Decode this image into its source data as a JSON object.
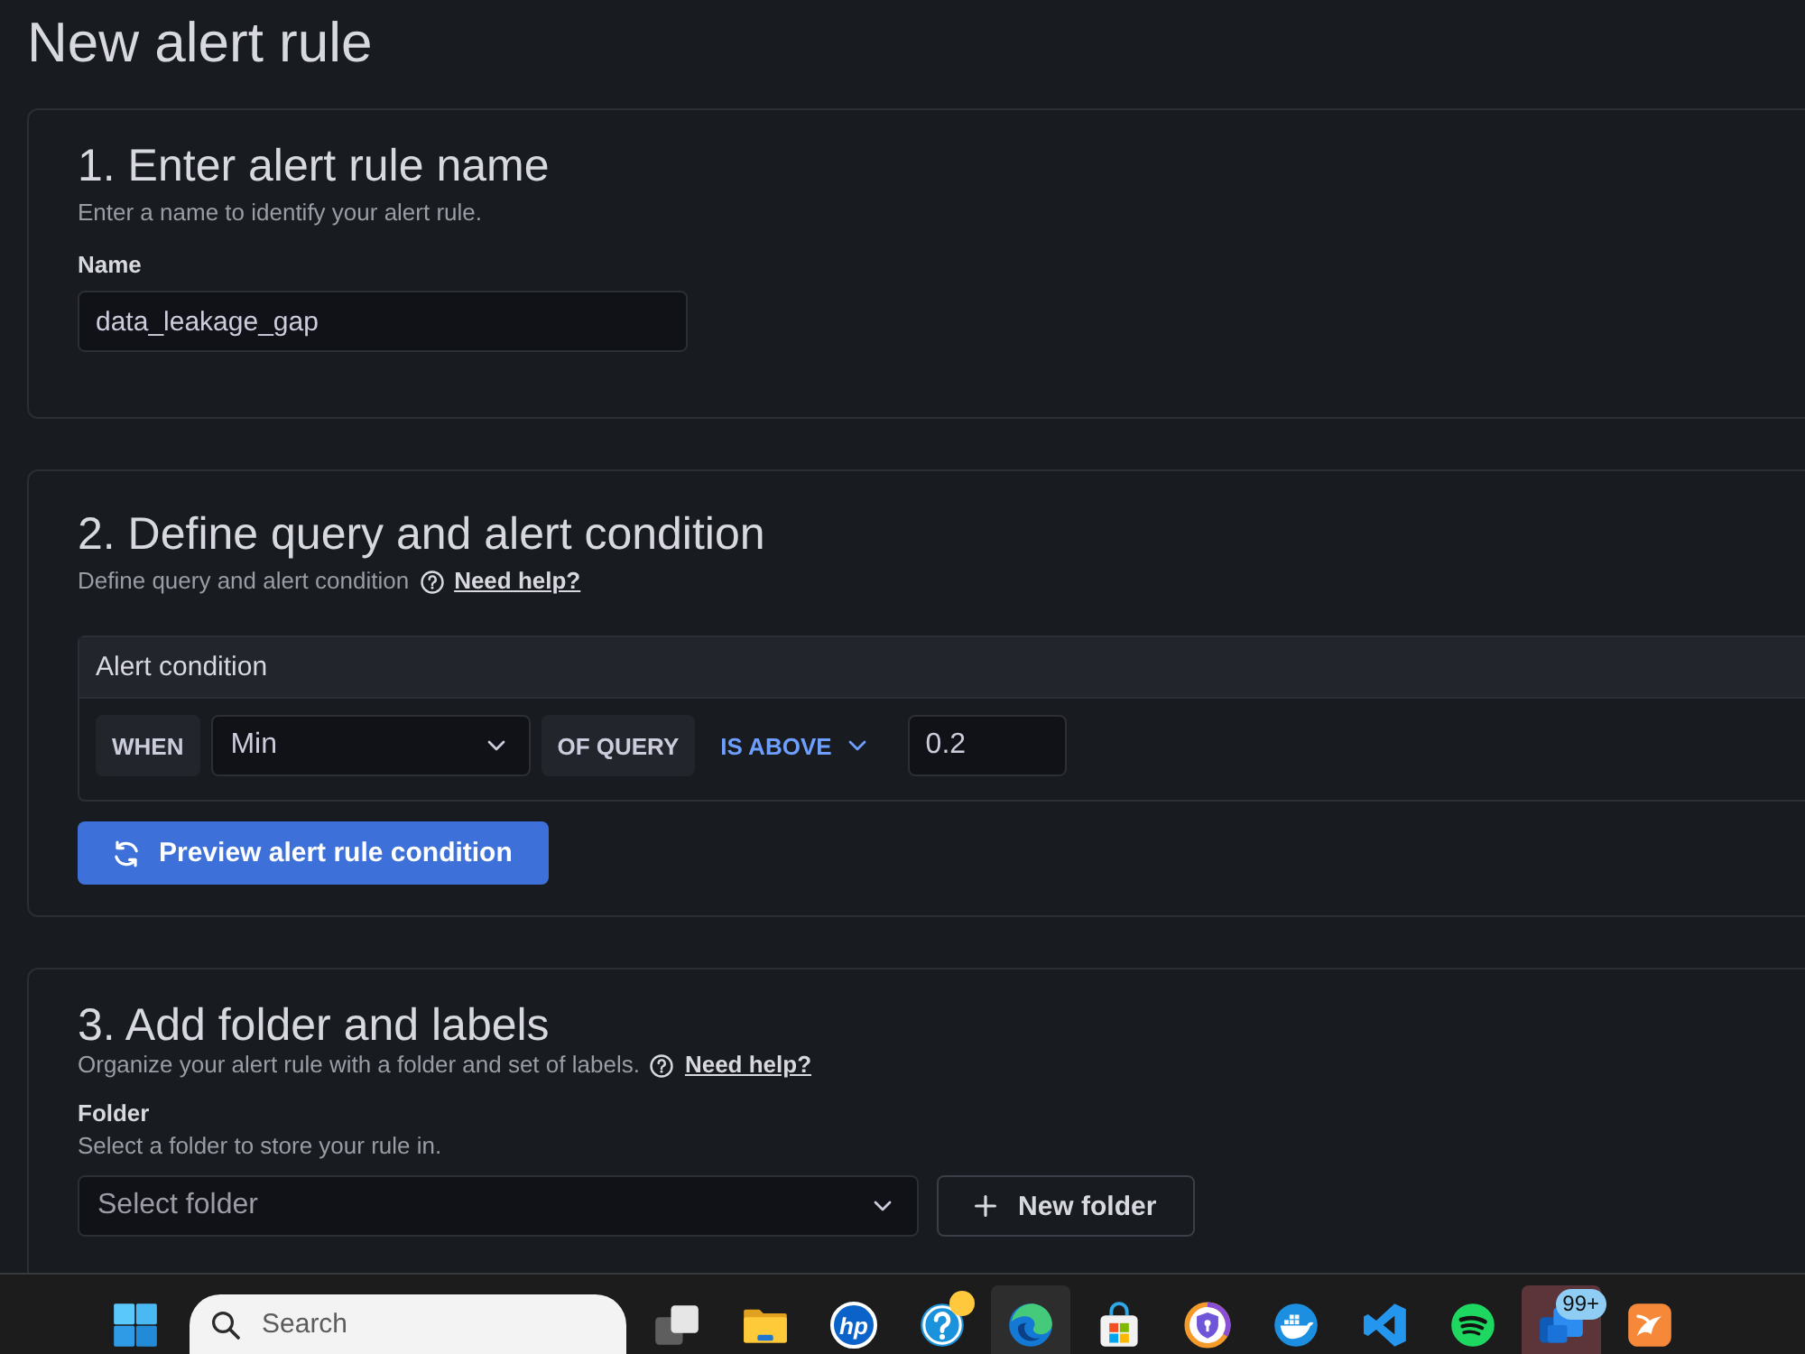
{
  "page": {
    "title": "New alert rule"
  },
  "sections": [
    {
      "kind": "name",
      "heading": "1. Enter alert rule name",
      "description": "Enter a name to identify your alert rule.",
      "field": {
        "label": "Name",
        "value": "data_leakage_gap"
      }
    },
    {
      "kind": "query",
      "heading": "2. Define query and alert condition",
      "description": "Define query and alert condition",
      "help_link": "Need help?",
      "condition": {
        "title": "Alert condition",
        "when": "WHEN",
        "reducer": "Min",
        "of_query": "OF QUERY",
        "evaluator": "IS ABOVE",
        "threshold": "0.2"
      },
      "button": "Preview alert rule condition"
    },
    {
      "kind": "folder",
      "heading": "3. Add folder and labels",
      "description": "Organize your alert rule with a folder and set of labels.",
      "help_link": "Need help?",
      "field": {
        "label": "Folder",
        "hint": "Select a folder to store your rule in.",
        "placeholder": "Select folder"
      },
      "button": "New folder"
    }
  ],
  "taskbar": {
    "items": [
      {
        "kind": "start",
        "selected": false,
        "attention": false,
        "dot": false
      },
      {
        "kind": "search",
        "placeholder": "Search",
        "selected": false,
        "attention": false,
        "dot": false
      },
      {
        "kind": "taskview",
        "selected": false,
        "attention": false,
        "dot": false
      },
      {
        "kind": "files",
        "selected": false,
        "attention": false,
        "dot": false
      },
      {
        "kind": "logo",
        "logo_text": "hp",
        "selected": false,
        "attention": false,
        "dot": false
      },
      {
        "kind": "help",
        "selected": false,
        "attention": false,
        "dot": true
      },
      {
        "kind": "swirl",
        "selected": true,
        "attention": false,
        "dot": false
      },
      {
        "kind": "store",
        "selected": false,
        "attention": false,
        "dot": false
      },
      {
        "kind": "shield",
        "selected": false,
        "attention": false,
        "dot": false
      },
      {
        "kind": "whale",
        "selected": false,
        "attention": false,
        "dot": false
      },
      {
        "kind": "ribbon",
        "selected": false,
        "attention": false,
        "dot": false
      },
      {
        "kind": "arcs",
        "selected": false,
        "attention": false,
        "dot": false
      },
      {
        "kind": "squares",
        "badge": "99+",
        "selected": false,
        "attention": true,
        "dot": false
      },
      {
        "kind": "swoosh",
        "selected": false,
        "attention": false,
        "dot": false
      }
    ]
  }
}
